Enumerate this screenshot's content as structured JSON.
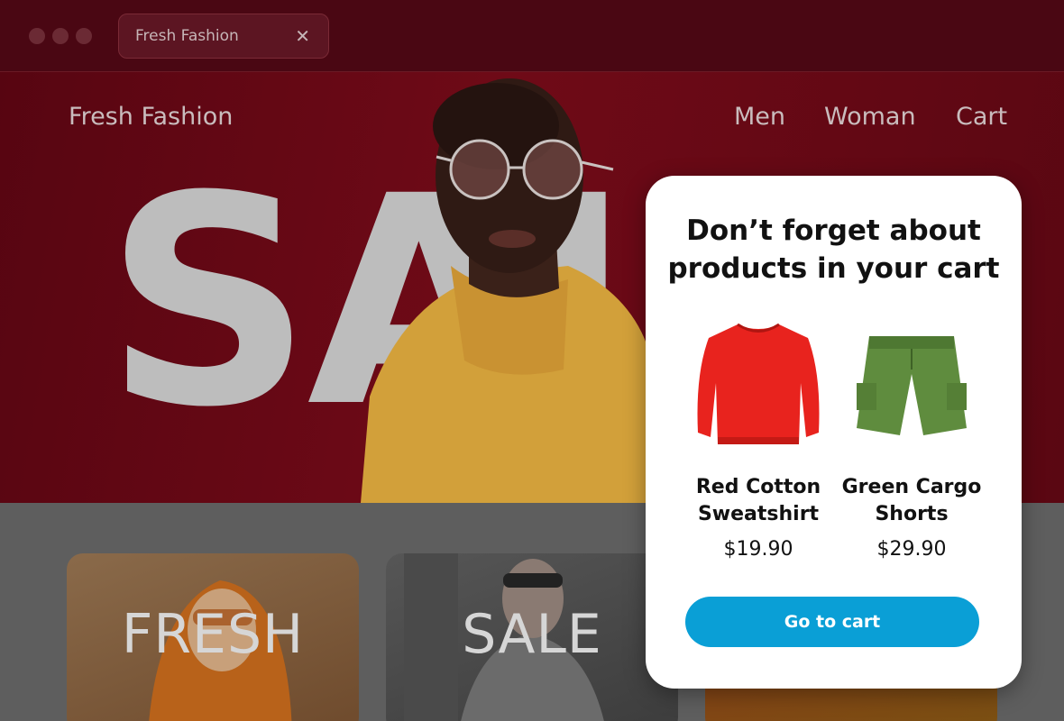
{
  "browser": {
    "tab_title": "Fresh Fashion",
    "tab_close": "✕"
  },
  "site": {
    "brand": "Fresh Fashion",
    "nav": [
      "Men",
      "Woman",
      "Cart"
    ],
    "hero_text": "SAL"
  },
  "categories": [
    {
      "label": "FRESH"
    },
    {
      "label": "SALE"
    },
    {
      "label": ""
    }
  ],
  "popup": {
    "title": "Don’t forget about products in your cart",
    "products": [
      {
        "name": "Red Cotton Sweatshirt",
        "price": "$19.90",
        "color": "#e8231e"
      },
      {
        "name": "Green Cargo Shorts",
        "price": "$29.90",
        "color": "#5f8c3e"
      }
    ],
    "cta_label": "Go to cart"
  },
  "colors": {
    "brand_dark_red": "#5a0712",
    "cta_blue": "#0a9fd6"
  }
}
